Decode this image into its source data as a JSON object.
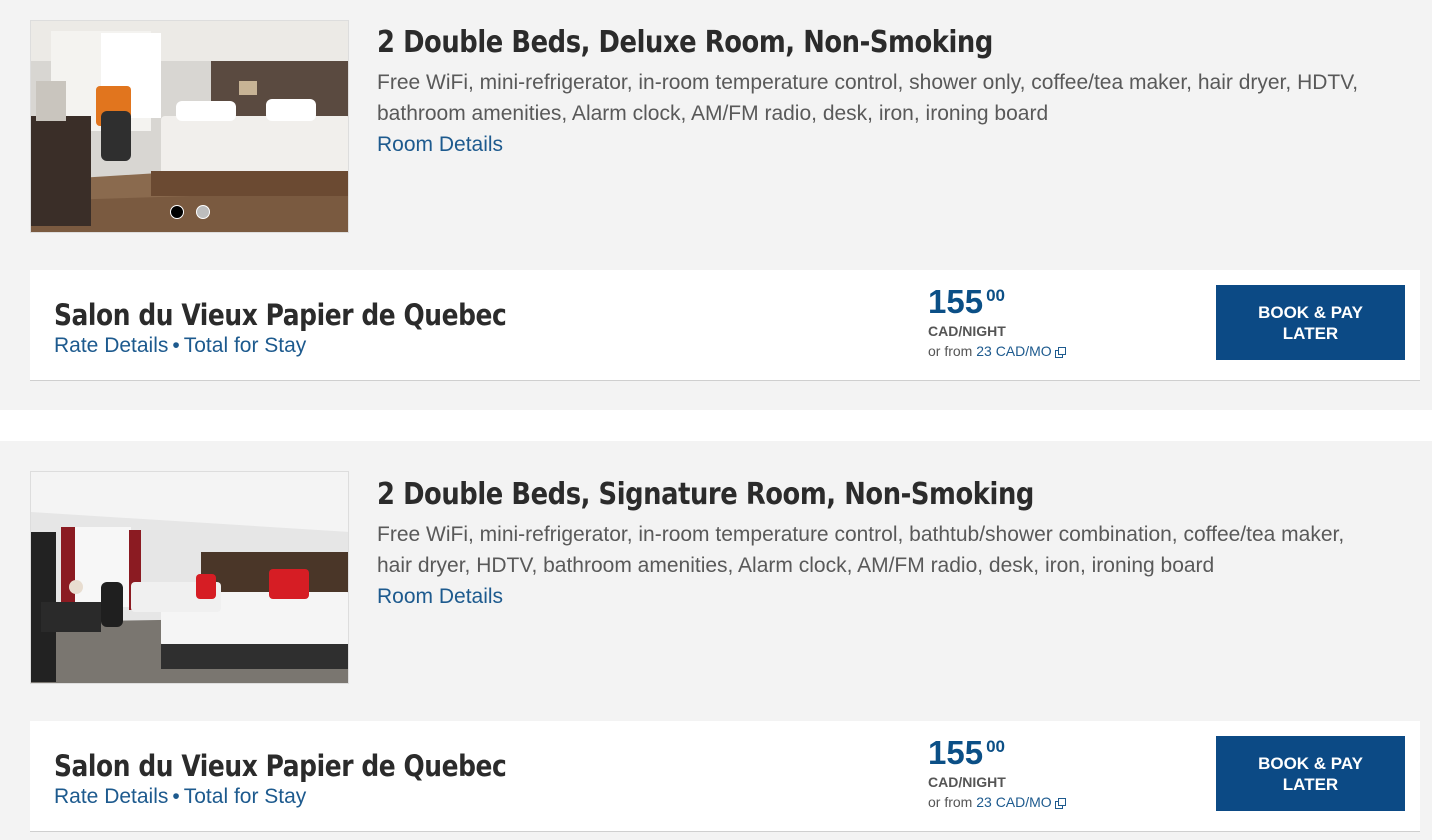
{
  "rooms": [
    {
      "title": "2 Double Beds, Deluxe Room, Non-Smoking",
      "description": "Free WiFi, mini-refrigerator, in-room temperature control, shower only, coffee/tea maker, hair dryer, HDTV, bathroom amenities, Alarm clock, AM/FM radio, desk, iron, ironing board",
      "details_link": "Room Details",
      "rate": {
        "name": "Salon du Vieux Papier de Quebec",
        "rate_details_link": "Rate Details",
        "separator": "•",
        "total_link": "Total for Stay",
        "price_main": "155",
        "price_cents": "00",
        "unit": "CAD/NIGHT",
        "from_prefix": "or from",
        "monthly": "23 CAD/MO",
        "book_label": "BOOK & PAY LATER"
      }
    },
    {
      "title": "2 Double Beds, Signature Room, Non-Smoking",
      "description": "Free WiFi, mini-refrigerator, in-room temperature control, bathtub/shower combination, coffee/tea maker, hair dryer, HDTV, bathroom amenities, Alarm clock, AM/FM radio, desk, iron, ironing board",
      "details_link": "Room Details",
      "rate": {
        "name": "Salon du Vieux Papier de Quebec",
        "rate_details_link": "Rate Details",
        "separator": "•",
        "total_link": "Total for Stay",
        "price_main": "155",
        "price_cents": "00",
        "unit": "CAD/NIGHT",
        "from_prefix": "or from",
        "monthly": "23 CAD/MO",
        "book_label": "BOOK & PAY LATER"
      }
    }
  ],
  "colors": {
    "accent": "#0c4a85",
    "link": "#1d5a8e",
    "price": "#0b4f86",
    "card_bg": "#f3f3f3"
  }
}
